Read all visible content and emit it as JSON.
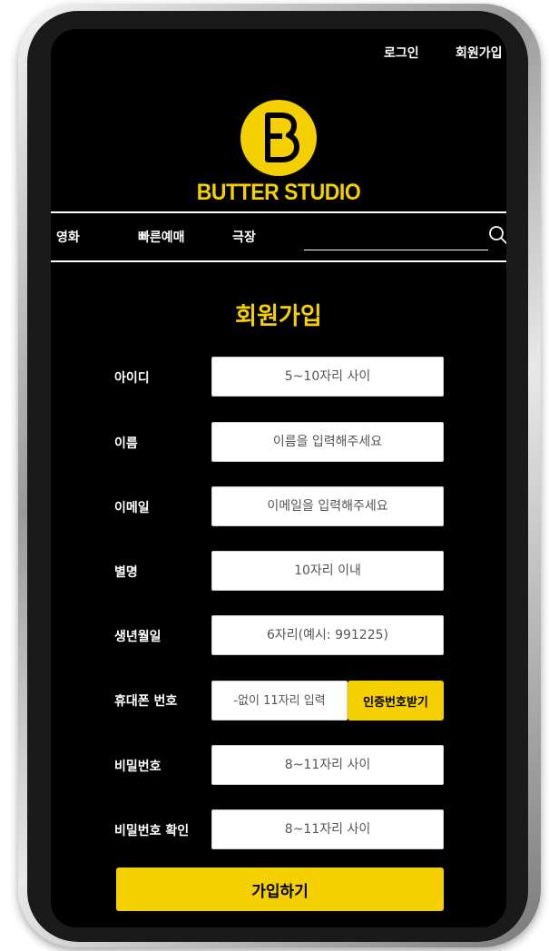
{
  "header": {
    "login_label": "로그인",
    "signup_label": "회원가입",
    "logo_text": "BUTTER STUDIO",
    "logo_icon": "butter-b-logo",
    "brand_color": "#F5D000"
  },
  "nav": {
    "items": [
      {
        "label": "영화"
      },
      {
        "label": "빠른예매"
      },
      {
        "label": "극장"
      }
    ],
    "search_placeholder": "",
    "search_icon": "search-icon"
  },
  "form": {
    "title": "회원가입",
    "fields": [
      {
        "label": "아이디",
        "placeholder": "5~10자리 사이",
        "value": ""
      },
      {
        "label": "이름",
        "placeholder": "이름을 입력해주세요",
        "value": ""
      },
      {
        "label": "이메일",
        "placeholder": "이메일을 입력해주세요",
        "value": ""
      },
      {
        "label": "별명",
        "placeholder": "10자리 이내",
        "value": ""
      },
      {
        "label": "생년월일",
        "placeholder": "6자리(예시: 991225)",
        "value": ""
      },
      {
        "label": "휴대폰 번호",
        "placeholder": "-없이 11자리 입력",
        "value": ""
      },
      {
        "label": "비밀번호",
        "placeholder": "8~11자리 사이",
        "value": ""
      },
      {
        "label": "비밀번호 확인",
        "placeholder": "8~11자리 사이",
        "value": ""
      }
    ],
    "verify_button_label": "인증번호받기",
    "submit_label": "가입하기"
  }
}
